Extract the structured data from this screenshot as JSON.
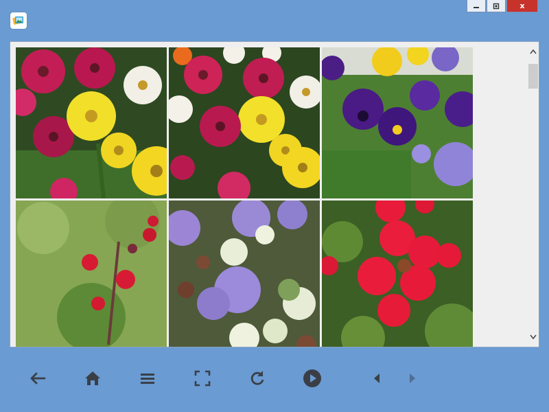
{
  "window": {
    "app_icon": "photo-gallery-icon",
    "controls": {
      "minimize": "minimize-icon",
      "maximize": "restore-icon",
      "close_label": "x"
    }
  },
  "gallery": {
    "photos": [
      {
        "name": "zinnias-pink-yellow",
        "icon": "photo"
      },
      {
        "name": "zinnias-pink-yellow-2",
        "icon": "photo"
      },
      {
        "name": "purple-pansies",
        "icon": "photo"
      },
      {
        "name": "red-salvia",
        "icon": "photo"
      },
      {
        "name": "ageratum-and-foliage",
        "icon": "photo"
      },
      {
        "name": "red-verbena",
        "icon": "photo"
      }
    ],
    "scroll_position": 0.05
  },
  "toolbar": {
    "buttons": [
      "back-arrow-icon",
      "home-icon",
      "menu-icon",
      "fullscreen-icon",
      "refresh-icon",
      "play-icon",
      "previous-icon",
      "next-icon"
    ]
  },
  "colors": {
    "window_frame": "#6a9bd2",
    "close_button": "#c7322b",
    "toolbar_icon": "#3a3f47",
    "toolbar_icon_disabled": "#4f6f95"
  }
}
